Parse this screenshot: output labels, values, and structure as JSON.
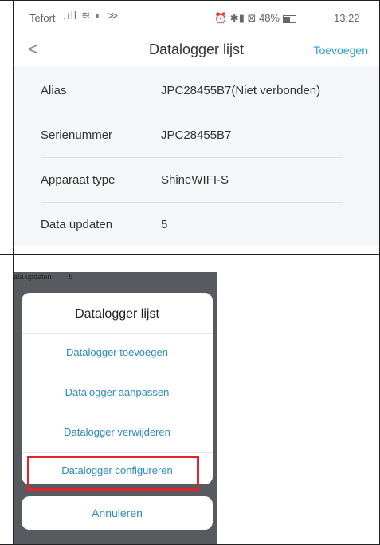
{
  "screen1": {
    "status_bar": {
      "carrier": "Tefort",
      "signal_icons": ".ıll ≋ ◐ ≫",
      "right_icons": "⏰ ✱▮ ⊠ 48%",
      "time": "13:22"
    },
    "nav": {
      "back": "<",
      "title": "Datalogger lijst",
      "add": "Toevoegen"
    },
    "rows": [
      {
        "label": "Alias",
        "value": "JPC28455B7(Niet verbonden)"
      },
      {
        "label": "Serienummer",
        "value": "JPC28455B7"
      },
      {
        "label": "Apparaat type",
        "value": "ShineWIFI-S"
      },
      {
        "label": "Data updaten",
        "value": "5"
      }
    ]
  },
  "screen2": {
    "background_row": {
      "label": "ata updaten",
      "value": "5"
    },
    "sheet_title": "Datalogger lijst",
    "items": [
      "Datalogger toevoegen",
      "Datalogger aanpassen",
      "Datalogger verwijderen",
      "Datalogger configureren"
    ],
    "highlighted_item": "Datalogger configureren",
    "highlight_color": "#e0262b",
    "cancel": "Annuleren"
  }
}
